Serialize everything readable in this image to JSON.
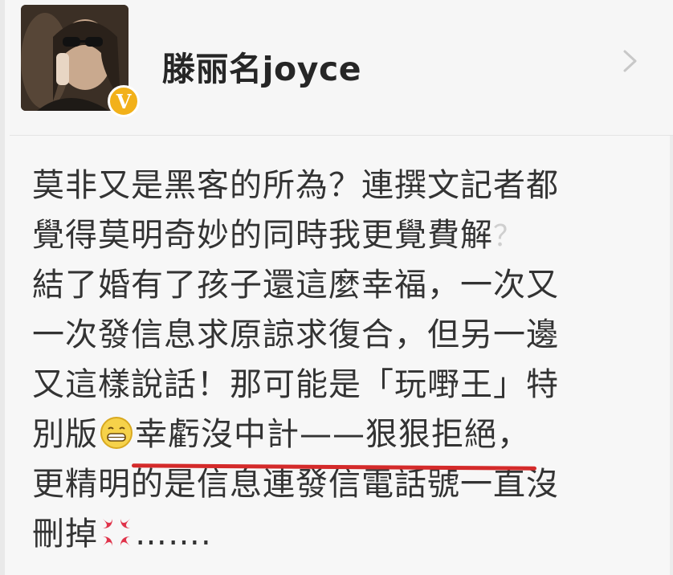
{
  "header": {
    "username": "滕丽名joyce",
    "badge_label": "V"
  },
  "post": {
    "line1": "莫非又是黑客的所為？連撰文記者都",
    "line2": "覺得莫明奇妙的同時我更覺費解",
    "line2_mark": "？",
    "line3": "結了婚有了孩子還這麼幸福，一次又",
    "line4": "一次發信息求原諒求復合，但另一邊",
    "line5": "又這樣說話！那可能是「玩嘢王」特",
    "line6_pre": "別版",
    "line6_underlined": "幸虧沒中計——狠狠拒絕，",
    "line7": "更精明的是信息連發信電話號一直沒",
    "line8_pre": "刪掉",
    "line8_post": "……."
  },
  "colors": {
    "underline": "#d42a2a",
    "badge": "#f2b11a",
    "text": "#333333"
  }
}
